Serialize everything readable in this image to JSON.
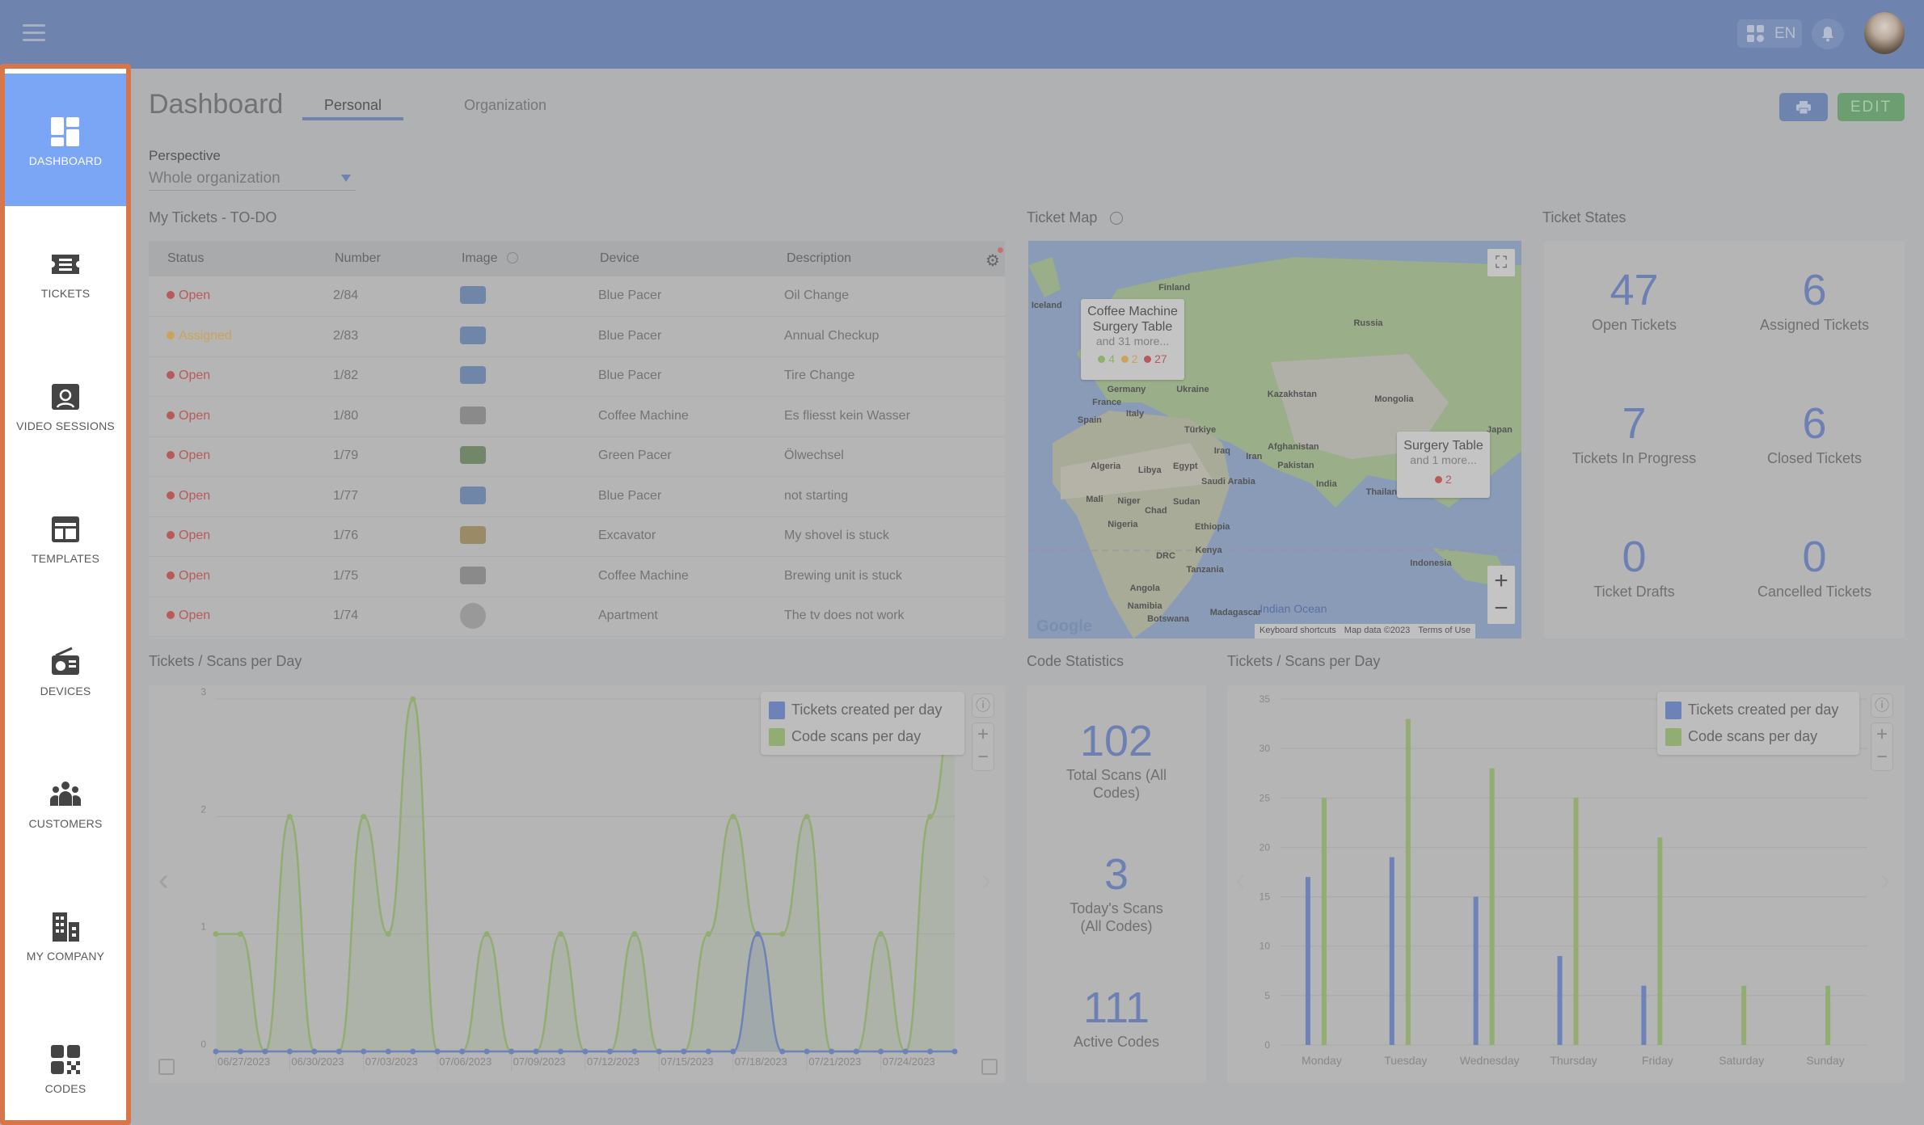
{
  "header": {
    "lang": "EN",
    "icons": [
      "menu-icon",
      "apps-icon",
      "bell-icon",
      "avatar"
    ]
  },
  "sidebar": {
    "items": [
      {
        "label": "DASHBOARD",
        "icon": "dashboard-icon",
        "active": true
      },
      {
        "label": "TICKETS",
        "icon": "ticket-icon"
      },
      {
        "label": "VIDEO SESSIONS",
        "icon": "video-session-icon"
      },
      {
        "label": "TEMPLATES",
        "icon": "template-icon"
      },
      {
        "label": "DEVICES",
        "icon": "device-icon"
      },
      {
        "label": "CUSTOMERS",
        "icon": "customers-icon"
      },
      {
        "label": "MY COMPANY",
        "icon": "company-icon"
      },
      {
        "label": "CODES",
        "icon": "qr-code-icon"
      }
    ],
    "highlight_color": "#d6764a"
  },
  "page": {
    "title": "Dashboard",
    "tabs": [
      {
        "label": "Personal",
        "active": true
      },
      {
        "label": "Organization"
      }
    ],
    "perspective_label": "Perspective",
    "perspective_value": "Whole organization",
    "edit_label": "EDIT"
  },
  "tickets": {
    "title": "My Tickets - TO-DO",
    "columns": [
      "Status",
      "Number",
      "Image",
      "Device",
      "Description"
    ],
    "rows": [
      {
        "status": "Open",
        "number": "2/84",
        "device": "Blue Pacer",
        "description": "Oil Change",
        "thumb": "#6f86a8"
      },
      {
        "status": "Assigned",
        "number": "2/83",
        "device": "Blue Pacer",
        "description": "Annual Checkup",
        "thumb": "#6f86a8"
      },
      {
        "status": "Open",
        "number": "1/82",
        "device": "Blue Pacer",
        "description": "Tire Change",
        "thumb": "#6f86a8"
      },
      {
        "status": "Open",
        "number": "1/80",
        "device": "Coffee Machine",
        "description": "Es fliesst kein Wasser",
        "thumb": "#8a8a8a"
      },
      {
        "status": "Open",
        "number": "1/79",
        "device": "Green Pacer",
        "description": "Ölwechsel",
        "thumb": "#72866a"
      },
      {
        "status": "Open",
        "number": "1/77",
        "device": "Blue Pacer",
        "description": "not starting",
        "thumb": "#6f86a8"
      },
      {
        "status": "Open",
        "number": "1/76",
        "device": "Excavator",
        "description": "My shovel is stuck",
        "thumb": "#9a8a66"
      },
      {
        "status": "Open",
        "number": "1/75",
        "device": "Coffee Machine",
        "description": "Brewing unit is stuck",
        "thumb": "#8a8a8a"
      },
      {
        "status": "Open",
        "number": "1/74",
        "device": "Apartment",
        "description": "The tv does not work",
        "thumb": "#999999"
      }
    ],
    "status_colors": {
      "Open": "#b85a5a",
      "Assigned": "#c9a45a"
    }
  },
  "map": {
    "title": "Ticket Map",
    "labels": [
      "Iceland",
      "Finland",
      "Russia",
      "Kazakhstan",
      "Mongolia",
      "Germany",
      "Ukraine",
      "France",
      "Spain",
      "Italy",
      "Türkiye",
      "Iraq",
      "Iran",
      "Afghanistan",
      "Pakistan",
      "India",
      "Algeria",
      "Libya",
      "Egypt",
      "Saudi Arabia",
      "Mali",
      "Niger",
      "Chad",
      "Sudan",
      "Nigeria",
      "Ethiopia",
      "Kenya",
      "DRC",
      "Tanzania",
      "Angola",
      "Namibia",
      "Botswana",
      "Madagascar",
      "Indonesia",
      "Japan",
      "Thailand",
      "Indian Ocean"
    ],
    "popups": [
      {
        "lines": [
          "Coffee Machine",
          "Surgery Table"
        ],
        "more": "and 31 more...",
        "counts": [
          {
            "value": "4",
            "color": "#8db06a"
          },
          {
            "value": "2",
            "color": "#c9a45a"
          },
          {
            "value": "27",
            "color": "#b85a5a"
          }
        ]
      },
      {
        "lines": [
          "Surgery Table"
        ],
        "more": "and 1 more...",
        "counts": [
          {
            "value": "2",
            "color": "#b85a5a"
          }
        ]
      }
    ],
    "attribution": {
      "logo": "Google",
      "shortcuts": "Keyboard shortcuts",
      "data": "Map data ©2023",
      "terms": "Terms of Use"
    }
  },
  "states": {
    "title": "Ticket States",
    "items": [
      {
        "value": "47",
        "label": "Open Tickets"
      },
      {
        "value": "6",
        "label": "Assigned Tickets"
      },
      {
        "value": "7",
        "label": "Tickets In Progress"
      },
      {
        "value": "6",
        "label": "Closed Tickets"
      },
      {
        "value": "0",
        "label": "Ticket Drafts"
      },
      {
        "value": "0",
        "label": "Cancelled Tickets"
      }
    ]
  },
  "code_stats": {
    "title": "Code Statistics",
    "items": [
      {
        "value": "102",
        "label": "Total Scans (All Codes)"
      },
      {
        "value": "3",
        "label": "Today's Scans (All Codes)"
      },
      {
        "value": "111",
        "label": "Active Codes"
      }
    ]
  },
  "chart_data": [
    {
      "type": "line",
      "title": "Tickets / Scans per Day",
      "x": [
        "06/27/2023",
        "06/28/2023",
        "06/29/2023",
        "06/30/2023",
        "07/01/2023",
        "07/02/2023",
        "07/03/2023",
        "07/04/2023",
        "07/05/2023",
        "07/06/2023",
        "07/07/2023",
        "07/08/2023",
        "07/09/2023",
        "07/10/2023",
        "07/11/2023",
        "07/12/2023",
        "07/13/2023",
        "07/14/2023",
        "07/15/2023",
        "07/16/2023",
        "07/17/2023",
        "07/18/2023",
        "07/19/2023",
        "07/20/2023",
        "07/21/2023",
        "07/22/2023",
        "07/23/2023",
        "07/24/2023",
        "07/25/2023",
        "07/26/2023",
        "07/27/2023"
      ],
      "tick_labels": [
        "06/27/2023",
        "06/30/2023",
        "07/03/2023",
        "07/06/2023",
        "07/09/2023",
        "07/12/2023",
        "07/15/2023",
        "07/18/2023",
        "07/21/2023",
        "07/24/2023"
      ],
      "series": [
        {
          "name": "Tickets created per day",
          "color": "#6d82b8",
          "values": [
            0,
            0,
            0,
            0,
            0,
            0,
            0,
            0,
            0,
            0,
            0,
            0,
            0,
            0,
            0,
            0,
            0,
            0,
            0,
            0,
            0,
            0,
            1,
            0,
            0,
            0,
            0,
            0,
            0,
            0,
            0
          ]
        },
        {
          "name": "Code scans per day",
          "color": "#92ad72",
          "values": [
            1,
            1,
            0,
            2,
            0,
            0,
            2,
            1,
            3,
            0,
            0,
            1,
            0,
            0,
            1,
            0,
            0,
            1,
            0,
            0,
            1,
            2,
            1,
            1,
            2,
            0,
            0,
            1,
            0,
            2,
            3
          ]
        }
      ],
      "yticks": [
        0,
        1,
        2,
        3
      ],
      "ylim": [
        0,
        3
      ],
      "grid": true,
      "legend": "top-right"
    },
    {
      "type": "bar",
      "title": "Tickets / Scans per Day",
      "categories": [
        "Monday",
        "Tuesday",
        "Wednesday",
        "Thursday",
        "Friday",
        "Saturday",
        "Sunday"
      ],
      "series": [
        {
          "name": "Tickets created per day",
          "color": "#6d82b8",
          "values": [
            17,
            19,
            15,
            9,
            6,
            0,
            0
          ]
        },
        {
          "name": "Code scans per day",
          "color": "#92ad72",
          "values": [
            25,
            33,
            28,
            25,
            21,
            6,
            6
          ]
        }
      ],
      "yticks": [
        0,
        5,
        10,
        15,
        20,
        25,
        30,
        35
      ],
      "ylim": [
        0,
        35
      ],
      "grid": true,
      "legend": "top-right"
    }
  ]
}
